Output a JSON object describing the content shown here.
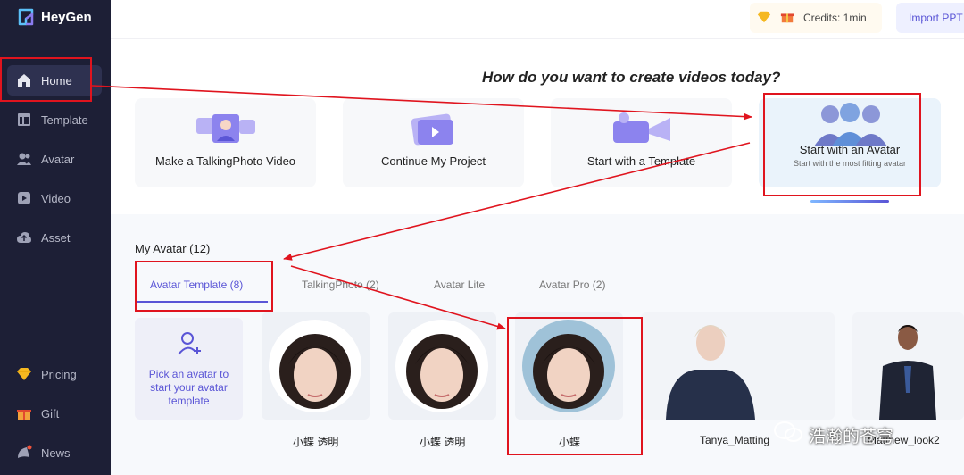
{
  "app": {
    "name": "HeyGen"
  },
  "sidebar": {
    "items": [
      {
        "label": "Home",
        "icon": "home-icon"
      },
      {
        "label": "Template",
        "icon": "template-icon"
      },
      {
        "label": "Avatar",
        "icon": "avatar-icon"
      },
      {
        "label": "Video",
        "icon": "video-icon"
      },
      {
        "label": "Asset",
        "icon": "asset-icon"
      }
    ],
    "bottom_items": [
      {
        "label": "Pricing",
        "icon": "diamond-icon"
      },
      {
        "label": "Gift",
        "icon": "gift-icon"
      },
      {
        "label": "News",
        "icon": "news-icon"
      }
    ]
  },
  "topbar": {
    "credits": "Credits: 1min",
    "import_label": "Import PPT"
  },
  "headline": "How do you want to create videos today?",
  "create_options": [
    {
      "label": "Make a TalkingPhoto Video",
      "sub": ""
    },
    {
      "label": "Continue My Project",
      "sub": ""
    },
    {
      "label": "Start with a Template",
      "sub": ""
    },
    {
      "label": "Start with an Avatar",
      "sub": "Start with the most fitting avatar"
    }
  ],
  "my_avatar": {
    "title": "My Avatar (12)",
    "tabs": [
      "Avatar Template (8)",
      "TalkingPhoto (2)",
      "Avatar Lite",
      "Avatar Pro (2)"
    ],
    "pick_text": "Pick an avatar to start your avatar template",
    "avatars": [
      {
        "name": "小蝶 透明"
      },
      {
        "name": "小蝶 透明"
      },
      {
        "name": "小蝶"
      },
      {
        "name": "Tanya_Matting"
      },
      {
        "name": "Matthew_look2"
      }
    ]
  },
  "watermark": "浩瀚的苍穹",
  "colors": {
    "sidebar_bg": "#1d1f36",
    "accent": "#5a55d6",
    "annotation": "#e0141e"
  }
}
